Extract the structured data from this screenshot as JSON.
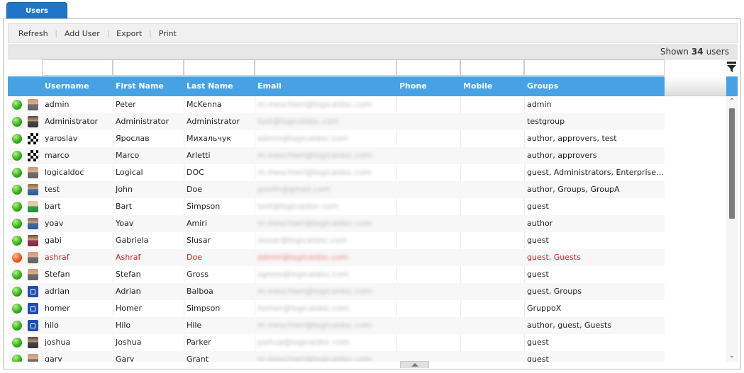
{
  "tab": {
    "label": "Users"
  },
  "toolbar": {
    "refresh": "Refresh",
    "add_user": "Add User",
    "export": "Export",
    "print": "Print"
  },
  "status": {
    "prefix": "Shown",
    "count": "34",
    "suffix": "users"
  },
  "columns": {
    "username": "Username",
    "first_name": "First Name",
    "last_name": "Last Name",
    "email": "Email",
    "phone": "Phone",
    "mobile": "Mobile",
    "groups": "Groups"
  },
  "colors": {
    "tab": "#1f76c8",
    "header": "#47a2e3",
    "enabled_status": "#36b11a",
    "disabled_status": "#f0561f",
    "disabled_text": "#d42020"
  },
  "rows": [
    {
      "enabled": true,
      "avatar": "photo-avatar",
      "username": "admin",
      "first_name": "Peter",
      "last_name": "McKenna",
      "email": "m.meschieri@logicaldoc.com",
      "groups": "admin"
    },
    {
      "enabled": true,
      "avatar": "photo-avatar",
      "username": "Administrator",
      "first_name": "Administrator",
      "last_name": "Administrator",
      "email": "test@logicaldoc.com",
      "groups": "testgroup"
    },
    {
      "enabled": true,
      "avatar": "pattern-avatar",
      "username": "yaroslav",
      "first_name": "Ярослав",
      "last_name": "Михальчук",
      "email": "admin@logicaldoc.com",
      "groups": "author, approvers, test"
    },
    {
      "enabled": true,
      "avatar": "pattern-avatar",
      "username": "marco",
      "first_name": "Marco",
      "last_name": "Arletti",
      "email": "m.meschieri@logicaldoc.com",
      "groups": "author, approvers"
    },
    {
      "enabled": true,
      "avatar": "photo-avatar",
      "username": "logicaldoc",
      "first_name": "Logical",
      "last_name": "DOC",
      "email": "m.meschieri@logicaldoc.com",
      "groups": "guest, Administrators, Enterprise Administrators"
    },
    {
      "enabled": true,
      "avatar": "photo-avatar",
      "username": "test",
      "first_name": "John",
      "last_name": "Doe",
      "email": "jsmith@gmail.com",
      "groups": "author, Groups, GroupA"
    },
    {
      "enabled": true,
      "avatar": "photo-avatar",
      "username": "bart",
      "first_name": "Bart",
      "last_name": "Simpson",
      "email": "test@logicaldoc.com",
      "groups": "guest"
    },
    {
      "enabled": true,
      "avatar": "photo-avatar",
      "username": "yoav",
      "first_name": "Yoav",
      "last_name": "Amiri",
      "email": "m.meschieri@logicaldoc.com",
      "groups": "author"
    },
    {
      "enabled": true,
      "avatar": "photo-avatar",
      "username": "gabi",
      "first_name": "Gabriela",
      "last_name": "Slusar",
      "email": "slusar@logicaldoc.com",
      "groups": "guest"
    },
    {
      "enabled": false,
      "avatar": "photo-avatar",
      "username": "ashraf",
      "first_name": "Ashraf",
      "last_name": "Doe",
      "email": "admin@logicaldoc.com",
      "groups": "guest, Guests"
    },
    {
      "enabled": true,
      "avatar": "photo-avatar",
      "username": "Stefan",
      "first_name": "Stefan",
      "last_name": "Gross",
      "email": "sgross@logicaldoc.com",
      "groups": "guest"
    },
    {
      "enabled": true,
      "avatar": "default-avatar",
      "username": "adrian",
      "first_name": "Adrian",
      "last_name": "Balboa",
      "email": "m.meschieri@logicaldoc.com",
      "groups": "guest, Groups"
    },
    {
      "enabled": true,
      "avatar": "default-avatar",
      "username": "homer",
      "first_name": "Homer",
      "last_name": "Simpson",
      "email": "homer@logicaldoc.com",
      "groups": "GruppoX"
    },
    {
      "enabled": true,
      "avatar": "default-avatar",
      "username": "hilo",
      "first_name": "Hilo",
      "last_name": "Hile",
      "email": "m.meschieri@logicaldoc.com",
      "groups": "author, guest, Guests"
    },
    {
      "enabled": true,
      "avatar": "photo-avatar",
      "username": "joshua",
      "first_name": "Joshua",
      "last_name": "Parker",
      "email": "joshua@logicaldoc.com",
      "groups": "guest"
    },
    {
      "enabled": true,
      "avatar": "photo-avatar",
      "username": "gary",
      "first_name": "Gary",
      "last_name": "Grant",
      "email": "m.meschieri@logicaldoc.com",
      "groups": "guest"
    }
  ]
}
